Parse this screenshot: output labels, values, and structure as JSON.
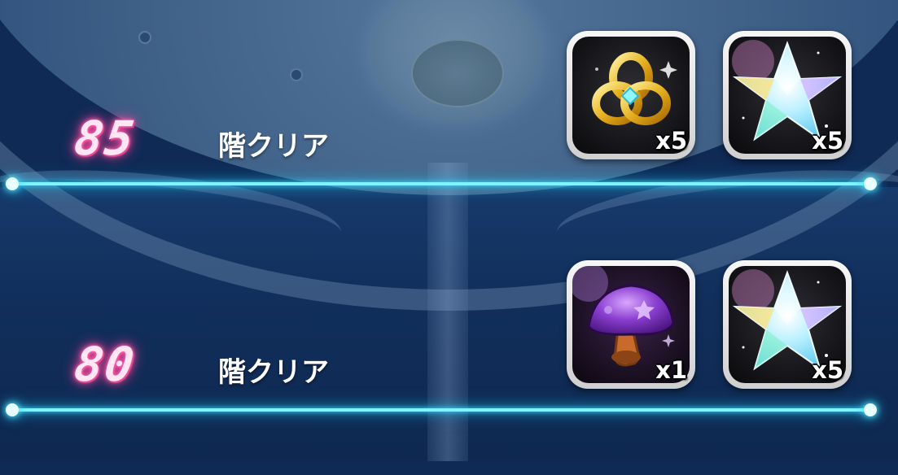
{
  "rewards_list": [
    {
      "floor": "85",
      "clear_label": "階クリア",
      "rewards": [
        {
          "icon": "golden-rings-icon",
          "quantity": "x5"
        },
        {
          "icon": "crystal-star-icon",
          "quantity": "x5"
        }
      ]
    },
    {
      "floor": "80",
      "clear_label": "階クリア",
      "rewards": [
        {
          "icon": "purple-mushroom-icon",
          "quantity": "x1"
        },
        {
          "icon": "crystal-star-icon",
          "quantity": "x5"
        }
      ]
    }
  ],
  "colors": {
    "floor_number_glow": "#ff4aa0",
    "divider_glow": "#3fe3ff",
    "background": "#0f2a55"
  }
}
